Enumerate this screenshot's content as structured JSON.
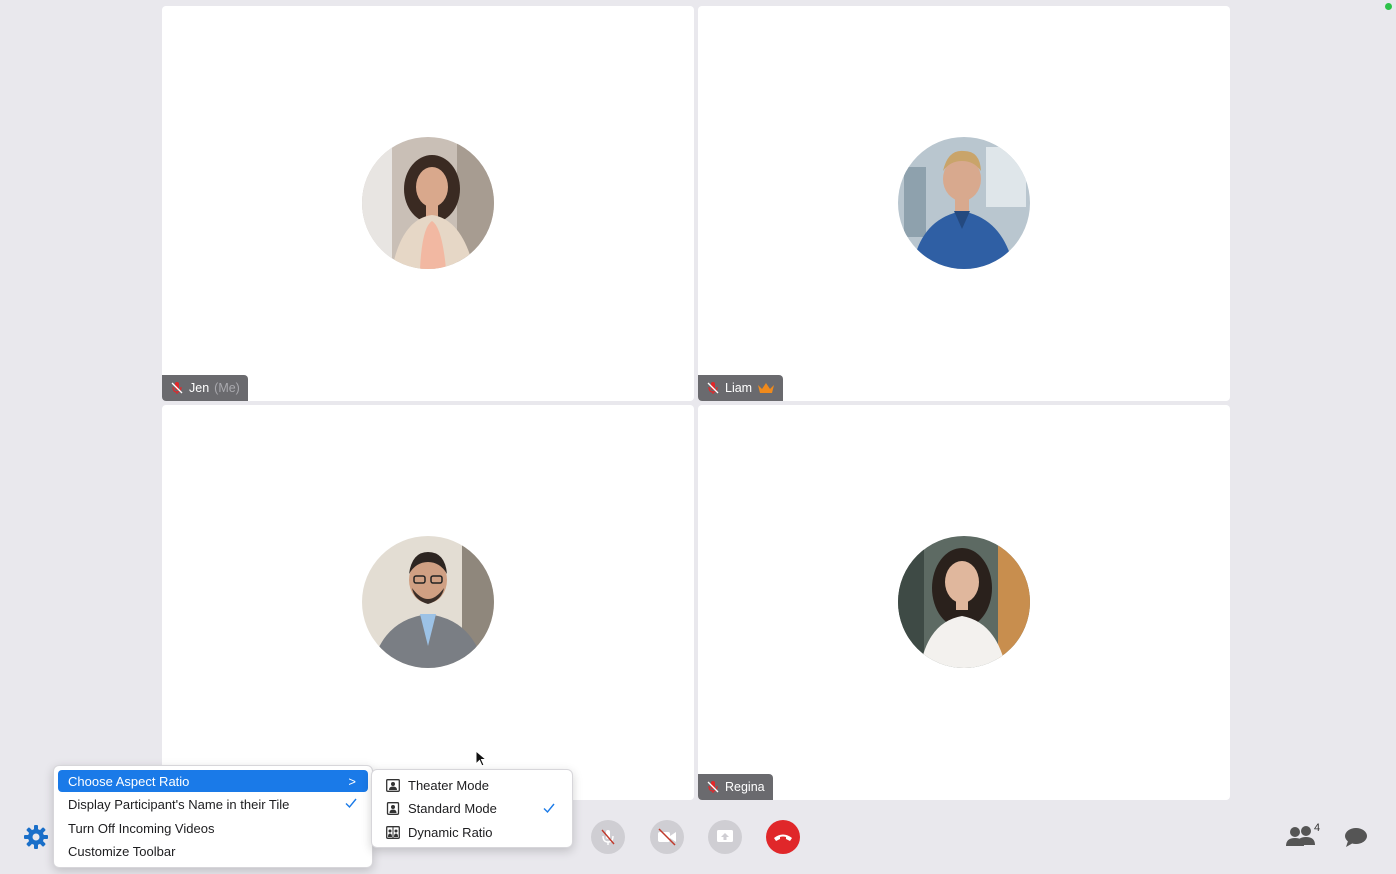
{
  "participants": [
    {
      "name": "Jen",
      "suffix": "(Me)",
      "muted": true,
      "host": false,
      "avatar": "portrait-woman-blazer"
    },
    {
      "name": "Liam",
      "suffix": "",
      "muted": true,
      "host": true,
      "avatar": "portrait-man-blue-shirt"
    },
    {
      "name": "",
      "suffix": "",
      "muted": false,
      "host": false,
      "avatar": "portrait-man-glasses-suit"
    },
    {
      "name": "Regina",
      "suffix": "",
      "muted": true,
      "host": false,
      "avatar": "portrait-woman-white-blouse"
    }
  ],
  "settings_menu": {
    "items": [
      {
        "label": "Choose Aspect Ratio",
        "highlighted": true,
        "submenu": true,
        "checked": false
      },
      {
        "label": "Display Participant's Name in their Tile",
        "highlighted": false,
        "submenu": false,
        "checked": true
      },
      {
        "label": "Turn Off Incoming Videos",
        "highlighted": false,
        "submenu": false,
        "checked": false
      },
      {
        "label": "Customize Toolbar",
        "highlighted": false,
        "submenu": false,
        "checked": false
      }
    ],
    "submenu_chevron": ">"
  },
  "aspect_ratio_menu": {
    "items": [
      {
        "label": "Theater Mode",
        "checked": false
      },
      {
        "label": "Standard Mode",
        "checked": true
      },
      {
        "label": "Dynamic Ratio",
        "checked": false
      }
    ]
  },
  "toolbar": {
    "participant_count": "4",
    "icons": [
      "gear-icon",
      "mic-muted-icon",
      "camera-off-icon",
      "share-screen-icon",
      "hang-up-icon",
      "participants-icon",
      "chat-icon"
    ]
  },
  "colors": {
    "background": "#e9e8ed",
    "accent": "#1a7ae8",
    "hang_up": "#e0272a",
    "host_crown": "#f08a1c",
    "muted_mic": "#e0272a",
    "status": "#2ec24a"
  }
}
